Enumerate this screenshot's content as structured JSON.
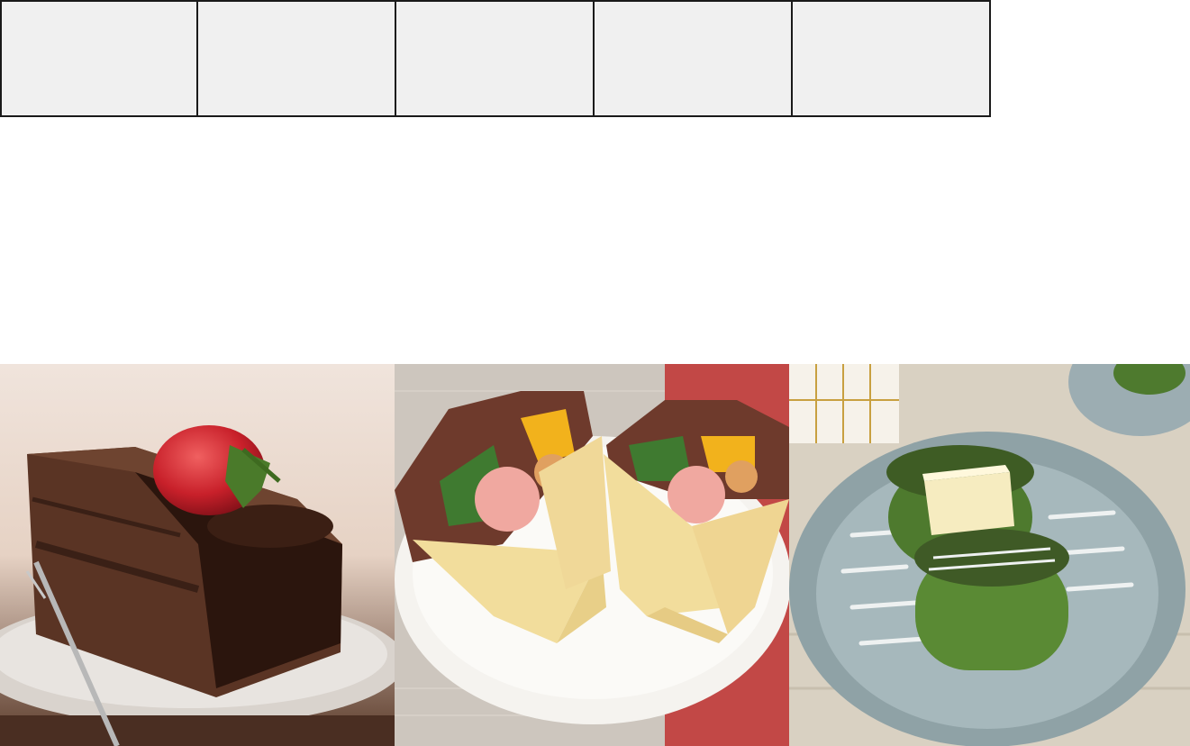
{
  "top_tiles": [
    {
      "id": "tile-1"
    },
    {
      "id": "tile-2"
    },
    {
      "id": "tile-3"
    },
    {
      "id": "tile-4"
    },
    {
      "id": "tile-5"
    }
  ],
  "photos": [
    {
      "subject": "chocolate-cake-with-strawberry",
      "colors": {
        "bg": "#e8d8cc",
        "cake": "#4a2a1c",
        "frosting": "#2a140c",
        "plate": "#d8d2cc",
        "berry": "#d0282a"
      }
    },
    {
      "subject": "crepe-wraps-on-plate",
      "colors": {
        "cloth": "#cfc8c0",
        "red_cloth": "#c44a48",
        "plate": "#f4f2ee",
        "crepe": "#f2dd9c",
        "lettuce": "#6b3a2a",
        "pepper": "#f4b41a",
        "shrimp": "#f0a89a"
      }
    },
    {
      "subject": "green-patties-with-butter",
      "colors": {
        "table": "#d8d0c0",
        "bowl": "#9eb0b4",
        "patty": "#4e7a2e",
        "butter": "#f6ecc0",
        "sauce": "#e8ecec"
      }
    }
  ]
}
